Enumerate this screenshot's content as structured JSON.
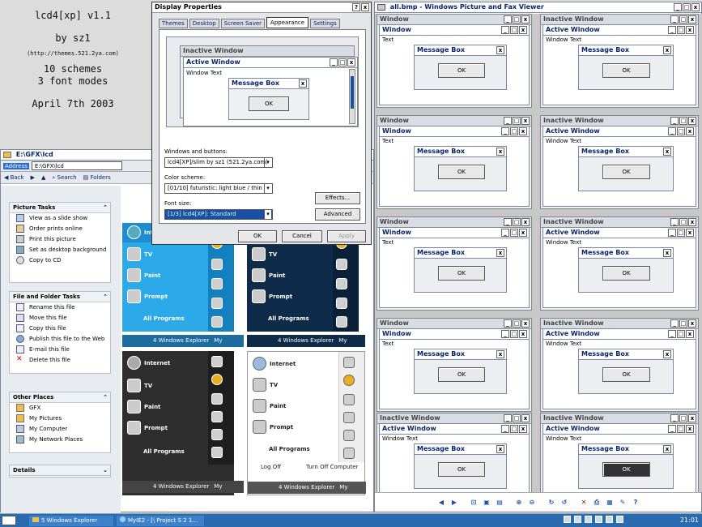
{
  "desktop": {
    "line1": "lcd4[xp] v1.1",
    "line2": "by sz1",
    "line3": "(http://themes.521.2ya.com)",
    "line4": "10 schemes",
    "line5": "3 font modes",
    "line6": "April 7th 2003"
  },
  "explorer": {
    "title": "E:\\GFX\\lcd",
    "address_label": "Address",
    "address": "E:\\GFX\\lcd",
    "back": "Back",
    "search": "Search",
    "folders": "Folders",
    "picture_tasks": {
      "header": "Picture Tasks",
      "items": [
        "View as a slide show",
        "Order prints online",
        "Print this picture",
        "Set as desktop background",
        "Copy to CD"
      ]
    },
    "file_tasks": {
      "header": "File and Folder Tasks",
      "items": [
        "Rename this file",
        "Move this file",
        "Copy this file",
        "Publish this file to the Web",
        "E-mail this file",
        "Delete this file"
      ]
    },
    "other_places": {
      "header": "Other Places",
      "items": [
        "GFX",
        "My Pictures",
        "My Computer",
        "My Network Places"
      ]
    },
    "details": {
      "header": "Details"
    }
  },
  "dialog": {
    "title": "Display Properties",
    "help": "?",
    "close": "x",
    "tabs": [
      "Themes",
      "Desktop",
      "Screen Saver",
      "Appearance",
      "Settings"
    ],
    "preview": {
      "inactive": "Inactive Window",
      "active": "Active Window",
      "window_text": "Window Text",
      "msgbox": "Message Box",
      "ok": "OK"
    },
    "windows_buttons_label": "Windows and buttons:",
    "windows_buttons_value": "lcd4[XP]/slim by sz1 (521.2ya.com)",
    "scheme_label": "Color scheme:",
    "scheme_value": "[01/10] futuristic: light blue / thin",
    "font_label": "Font size:",
    "font_value": "[1/3] lcd4[XP]: Standard",
    "effects": "Effects...",
    "advanced": "Advanced",
    "ok": "OK",
    "cancel": "Cancel",
    "apply": "Apply"
  },
  "viewer": {
    "title": "all.bmp - Windows Picture and Fax Viewer"
  },
  "samples": {
    "window": "Window",
    "inactive": "Inactive Window",
    "active": "Active Window",
    "window_text": "Window Text",
    "text": "Text",
    "msgbox": "Message Box",
    "ok": "OK"
  },
  "startmenus": {
    "internet": "Internet",
    "tv": "TV",
    "paint": "Paint",
    "prompt": "Prompt",
    "all_programs": "All Programs",
    "log_off": "Log Off",
    "turn_off": "Turn Off Computer",
    "inter": "Inter",
    "task_label": "4 Windows Explorer",
    "my": "My"
  },
  "taskbar": {
    "item1": "5 Windows Explorer",
    "item2": "MyIE2 - [\\ Project S 2 1...",
    "clock": "21:01"
  },
  "colors": {
    "accent": "#0a246a",
    "sm_blue": "#2ba9e8",
    "sm_dark": "#0e2b4a",
    "taskbar": "#2a6bb0"
  }
}
